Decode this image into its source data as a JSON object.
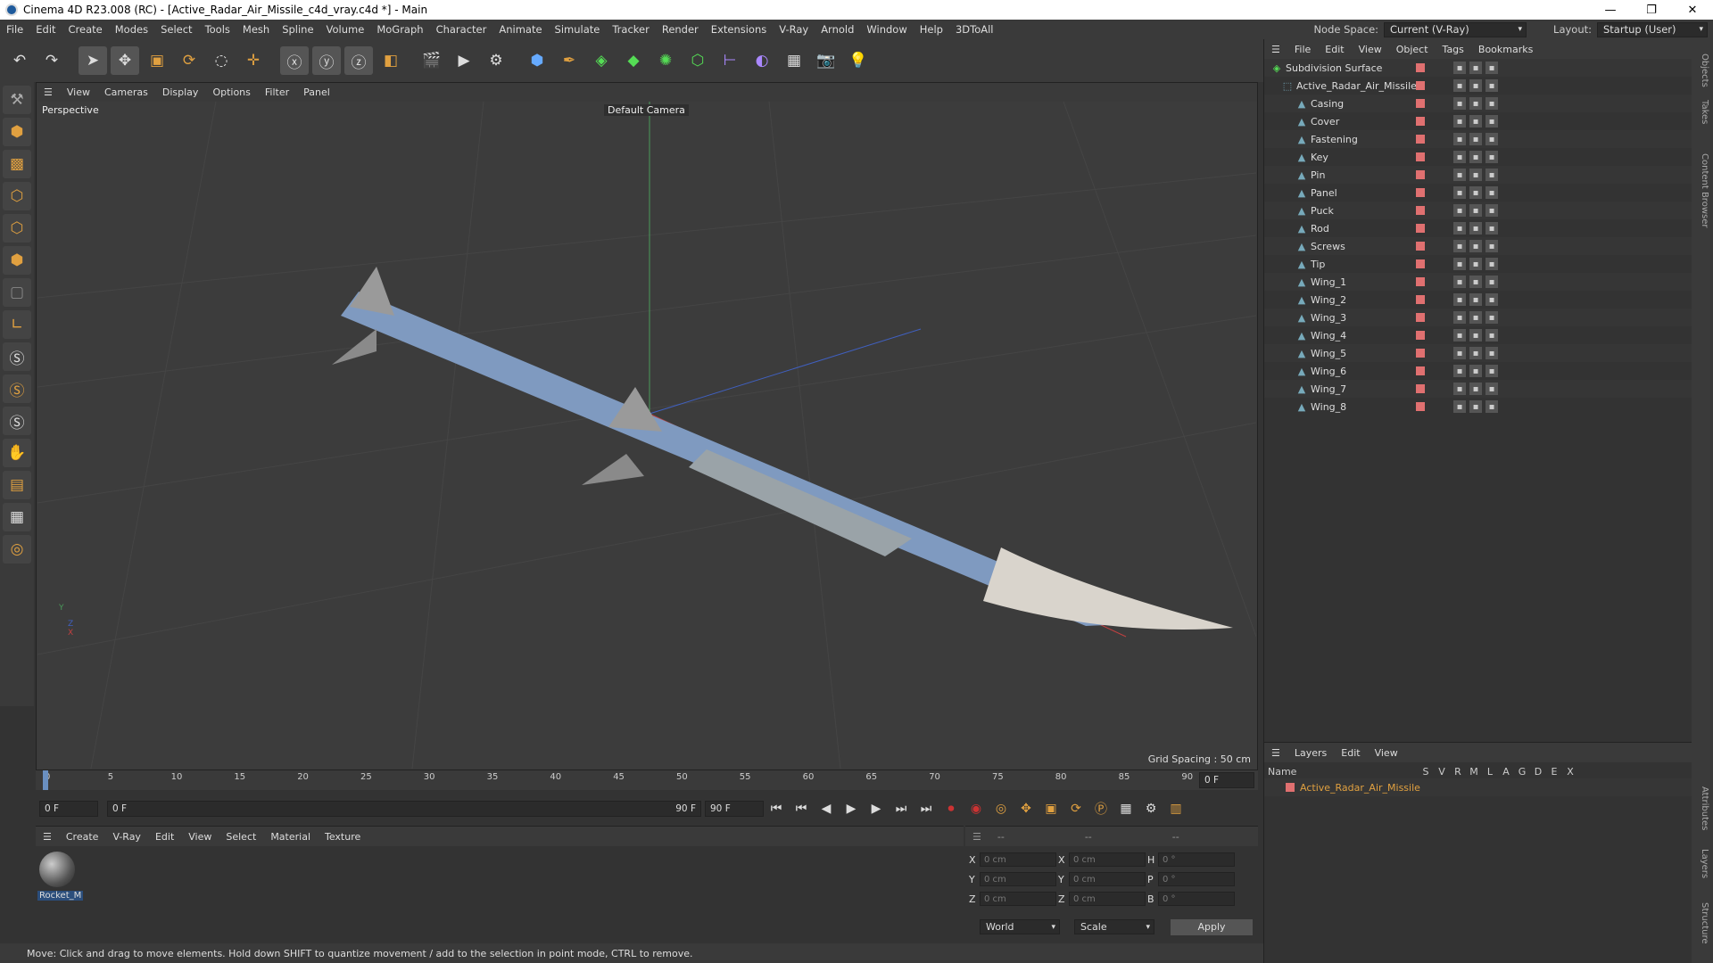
{
  "window": {
    "title": "Cinema 4D R23.008 (RC) - [Active_Radar_Air_Missile_c4d_vray.c4d *] - Main",
    "controls": [
      "—",
      "❐",
      "✕"
    ]
  },
  "menubar": {
    "items": [
      "File",
      "Edit",
      "Create",
      "Modes",
      "Select",
      "Tools",
      "Mesh",
      "Spline",
      "Volume",
      "MoGraph",
      "Character",
      "Animate",
      "Simulate",
      "Tracker",
      "Render",
      "Extensions",
      "V-Ray",
      "Arnold",
      "Window",
      "Help",
      "3DToAll"
    ],
    "node_space_label": "Node Space:",
    "node_space_value": "Current (V-Ray)",
    "layout_label": "Layout:",
    "layout_value": "Startup (User)"
  },
  "viewport": {
    "menu": [
      "View",
      "Cameras",
      "Display",
      "Options",
      "Filter",
      "Panel"
    ],
    "projection": "Perspective",
    "camera": "Default Camera",
    "grid_spacing": "Grid Spacing : 50 cm"
  },
  "timeline": {
    "ticks": [
      "0",
      "5",
      "10",
      "15",
      "20",
      "25",
      "30",
      "35",
      "40",
      "45",
      "50",
      "55",
      "60",
      "65",
      "70",
      "75",
      "80",
      "85",
      "90"
    ],
    "current_frame_field": "0 F",
    "start_field": "0 F",
    "range_start": "0 F",
    "range_end": "90 F",
    "end_field": "90 F"
  },
  "material_panel": {
    "menu": [
      "Create",
      "V-Ray",
      "Edit",
      "View",
      "Select",
      "Material",
      "Texture"
    ],
    "material_name": "Rocket_M"
  },
  "coordinates": {
    "head": [
      "--",
      "--",
      "--"
    ],
    "rows": [
      {
        "a": "X",
        "av": "0 cm",
        "b": "X",
        "bv": "0 cm",
        "c": "H",
        "cv": "0 °"
      },
      {
        "a": "Y",
        "av": "0 cm",
        "b": "Y",
        "bv": "0 cm",
        "c": "P",
        "cv": "0 °"
      },
      {
        "a": "Z",
        "av": "0 cm",
        "b": "Z",
        "bv": "0 cm",
        "c": "B",
        "cv": "0 °"
      }
    ],
    "world": "World",
    "scale": "Scale",
    "apply": "Apply"
  },
  "status": "Move: Click and drag to move elements. Hold down SHIFT to quantize movement / add to the selection in point mode, CTRL to remove.",
  "objects": {
    "menu": [
      "File",
      "Edit",
      "View",
      "Object",
      "Tags",
      "Bookmarks"
    ],
    "root": "Subdivision Surface",
    "group": "Active_Radar_Air_Missile",
    "children": [
      "Casing",
      "Cover",
      "Fastening",
      "Key",
      "Pin",
      "Panel",
      "Puck",
      "Rod",
      "Screws",
      "Tip",
      "Wing_1",
      "Wing_2",
      "Wing_3",
      "Wing_4",
      "Wing_5",
      "Wing_6",
      "Wing_7",
      "Wing_8"
    ]
  },
  "layers": {
    "menu": [
      "Layers",
      "Edit",
      "View"
    ],
    "columns": [
      "Name",
      "S",
      "V",
      "R",
      "M",
      "L",
      "A",
      "G",
      "D",
      "E",
      "X"
    ],
    "rows": [
      "Active_Radar_Air_Missile"
    ]
  },
  "side_tabs": [
    "Objects",
    "Takes",
    "Content Browser",
    "Attributes",
    "Layers",
    "Structure"
  ]
}
